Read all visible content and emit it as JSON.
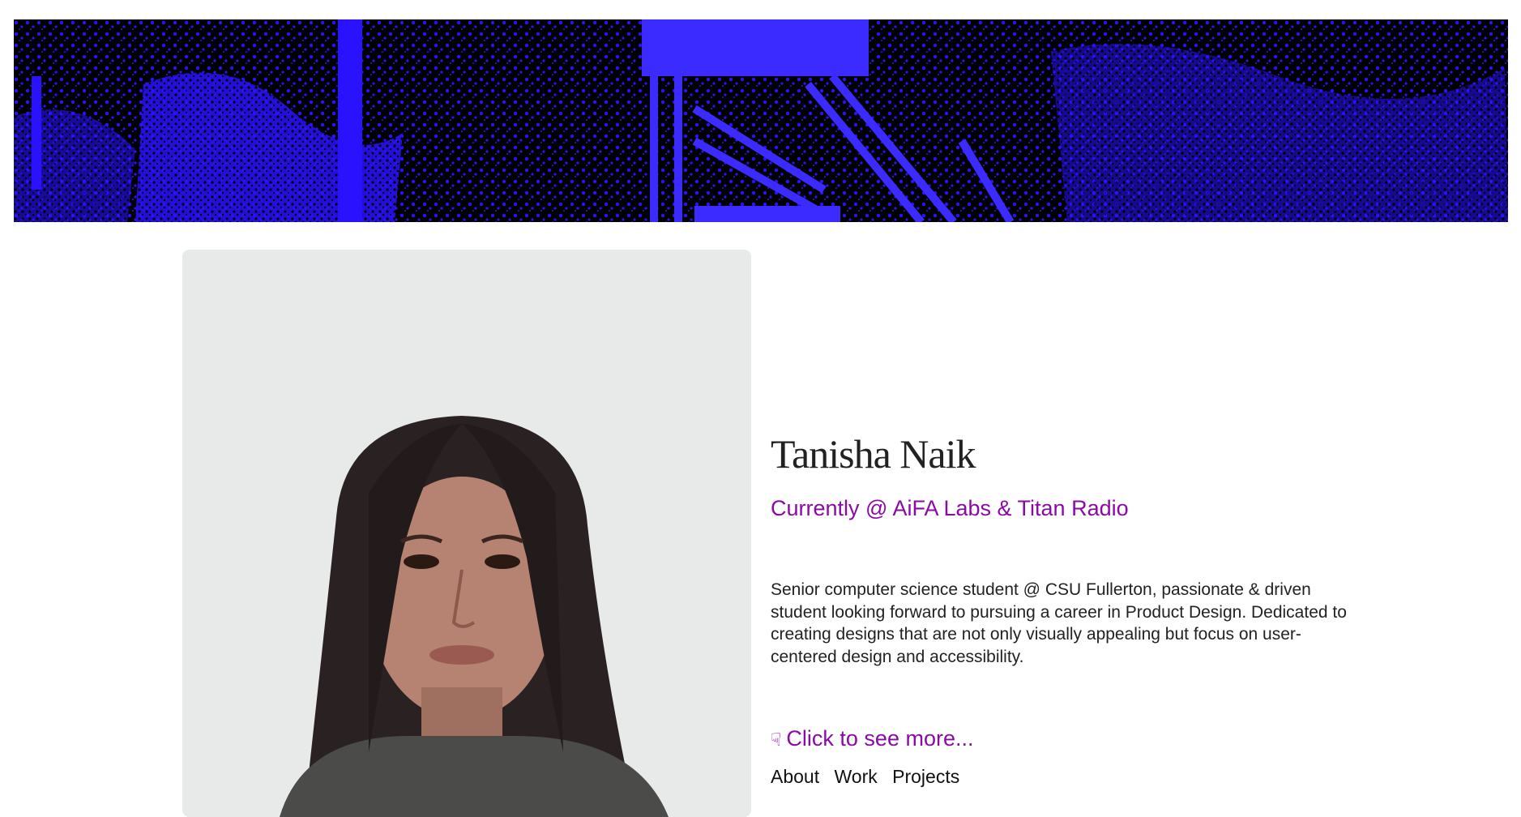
{
  "header": {
    "banner_image": "blue-duotone-forest-stairs-banner"
  },
  "profile": {
    "photo": "portrait-photo",
    "name": "Tanisha Naik",
    "current": "Currently @ AiFA Labs & Titan Radio",
    "bio": "Senior computer science student @ CSU Fullerton, passionate & driven student looking forward to pursuing a career in Product Design. Dedicated to creating designs that are not only visually appealing but focus on user-centered design and accessibility.",
    "more_icon": "pointing-hand-icon",
    "more_label": "Click to see more..."
  },
  "nav": {
    "items": [
      "About",
      "Work",
      "Projects"
    ]
  },
  "colors": {
    "accent": "#8b0aa5",
    "banner_blue": "#2a12ff",
    "text": "#222222"
  }
}
